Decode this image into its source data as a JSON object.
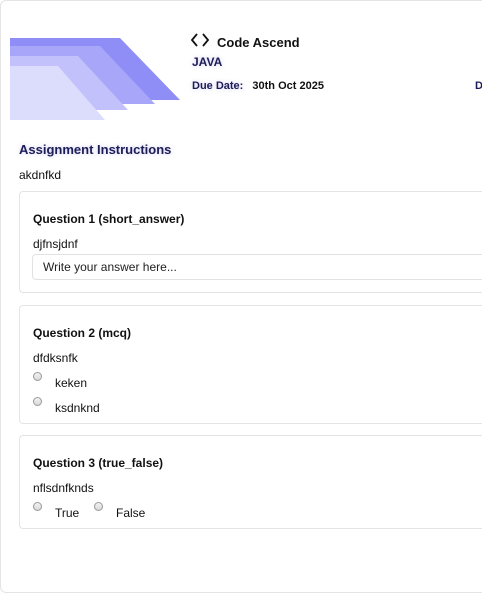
{
  "header": {
    "brand_name": "Code Ascend",
    "course": "JAVA",
    "due_label": "Due Date:",
    "due_value": "30th  Oct 2025",
    "right_cutoff": "D",
    "banner_colors": [
      "#8f8ef6",
      "#a7a6f8",
      "#c2c1fb",
      "#dcdcfd"
    ]
  },
  "instructions": {
    "title": "Assignment Instructions",
    "body": "akdnfkd"
  },
  "questions": [
    {
      "title": "Question 1 (short_answer)",
      "text": "djfnsjdnf",
      "answer_placeholder": "Write your answer here..."
    },
    {
      "title": "Question 2 (mcq)",
      "text": "dfdksnfk",
      "options": [
        "keken",
        "ksdnknd"
      ]
    },
    {
      "title": "Question 3 (true_false)",
      "text": "nflsdnfknds",
      "options": [
        "True",
        "False"
      ]
    }
  ]
}
